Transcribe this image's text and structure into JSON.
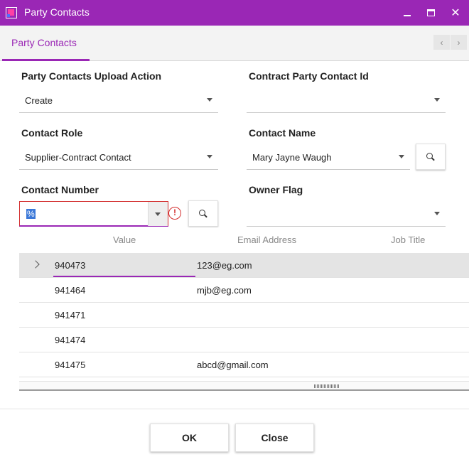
{
  "window": {
    "title": "Party Contacts",
    "controls": {
      "minimize": "minimize",
      "maximize": "maximize",
      "close": "✕"
    }
  },
  "tabs": [
    {
      "label": "Party Contacts",
      "active": true
    }
  ],
  "tab_nav": {
    "prev": "‹",
    "next": "›"
  },
  "form": {
    "upload_action": {
      "label": "Party Contacts Upload Action",
      "value": "Create"
    },
    "contract_party_contact_id": {
      "label": "Contract Party Contact Id",
      "value": ""
    },
    "contact_role": {
      "label": "Contact Role",
      "value": "Supplier-Contract Contact"
    },
    "contact_name": {
      "label": "Contact Name",
      "value": "Mary Jayne Waugh"
    },
    "contact_number": {
      "label": "Contact Number",
      "value": "%",
      "error_icon": "!"
    },
    "owner_flag": {
      "label": "Owner Flag",
      "value": ""
    }
  },
  "grid": {
    "columns": [
      "Value",
      "Email Address",
      "Job Title"
    ],
    "rows": [
      {
        "value": "940473",
        "email": "123@eg.com",
        "selected": true
      },
      {
        "value": "941464",
        "email": "mjb@eg.com"
      },
      {
        "value": "941471",
        "email": ""
      },
      {
        "value": "941474",
        "email": ""
      },
      {
        "value": "941475",
        "email": "abcd@gmail.com"
      }
    ]
  },
  "buttons": {
    "ok": "OK",
    "close": "Close"
  },
  "colors": {
    "accent": "#9a27b5",
    "error": "#d32f2f",
    "selection": "#3b78d8"
  },
  "icons": [
    "app-icon",
    "minimize-icon",
    "maximize-icon",
    "close-icon",
    "chevron-left-icon",
    "chevron-right-icon",
    "chevron-down-icon",
    "search-icon",
    "error-icon",
    "expand-row-icon"
  ]
}
